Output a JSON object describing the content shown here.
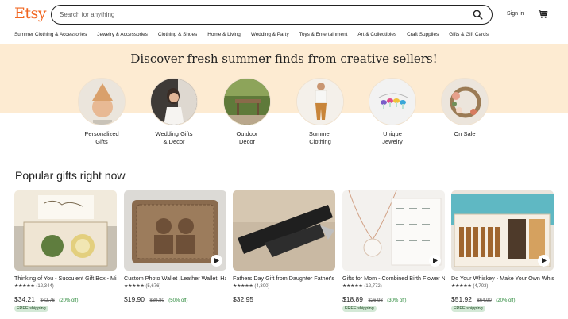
{
  "header": {
    "logo": "Etsy",
    "search_placeholder": "Search for anything",
    "signin_label": "Sign in"
  },
  "categories": [
    "Summer Clothing & Accessories",
    "Jewelry & Accessories",
    "Clothing & Shoes",
    "Home & Living",
    "Wedding & Party",
    "Toys & Entertainment",
    "Art & Collectibles",
    "Craft Supplies",
    "Gifts & Gift Cards"
  ],
  "banner": {
    "title": "Discover fresh summer finds from creative sellers!",
    "circles": [
      {
        "line1": "Personalized",
        "line2": "Gifts"
      },
      {
        "line1": "Wedding Gifts",
        "line2": "& Decor"
      },
      {
        "line1": "Outdoor",
        "line2": "Decor"
      },
      {
        "line1": "Summer",
        "line2": "Clothing"
      },
      {
        "line1": "Unique",
        "line2": "Jewelry"
      },
      {
        "line1": "On Sale",
        "line2": ""
      }
    ]
  },
  "popular": {
    "title": "Popular gifts right now",
    "items": [
      {
        "title": "Thinking of You - Succulent Gift Box - Missing You - Friendship...",
        "stars": "★★★★★",
        "count": "(12,344)",
        "price": "$34.21",
        "original": "$42.76",
        "discount": "(20% off)",
        "shipping": "FREE shipping",
        "play": false
      },
      {
        "title": "Custom Photo Wallet ,Leather Wallet, Handwriting Wallets G...",
        "stars": "★★★★★",
        "count": "(5,676)",
        "price": "$19.90",
        "original": "$39.80",
        "discount": "(50% off)",
        "shipping": "",
        "play": true
      },
      {
        "title": "Fathers Day Gift from Daughter Father's Day Gift from Wife Fir...",
        "stars": "★★★★★",
        "count": "(4,300)",
        "price": "$32.95",
        "original": "",
        "discount": "",
        "shipping": "",
        "play": false
      },
      {
        "title": "Gifts for Mom - Combined Birth Flower Necklace - Personalize...",
        "stars": "★★★★★",
        "count": "(12,772)",
        "price": "$18.89",
        "original": "$26.98",
        "discount": "(30% off)",
        "shipping": "FREE shipping",
        "play": true
      },
      {
        "title": "Do Your Whiskey - Make Your Own Whiskey | Whiskey Makin...",
        "stars": "★★★★★",
        "count": "(4,703)",
        "price": "$51.92",
        "original": "$64.90",
        "discount": "(20% off)",
        "shipping": "FREE shipping",
        "play": true
      }
    ]
  },
  "colors": {
    "brand": "#f1641e",
    "banner_bg": "#fdebd2",
    "discount_green": "#258635",
    "shipping_bg": "#d4e9d7"
  }
}
